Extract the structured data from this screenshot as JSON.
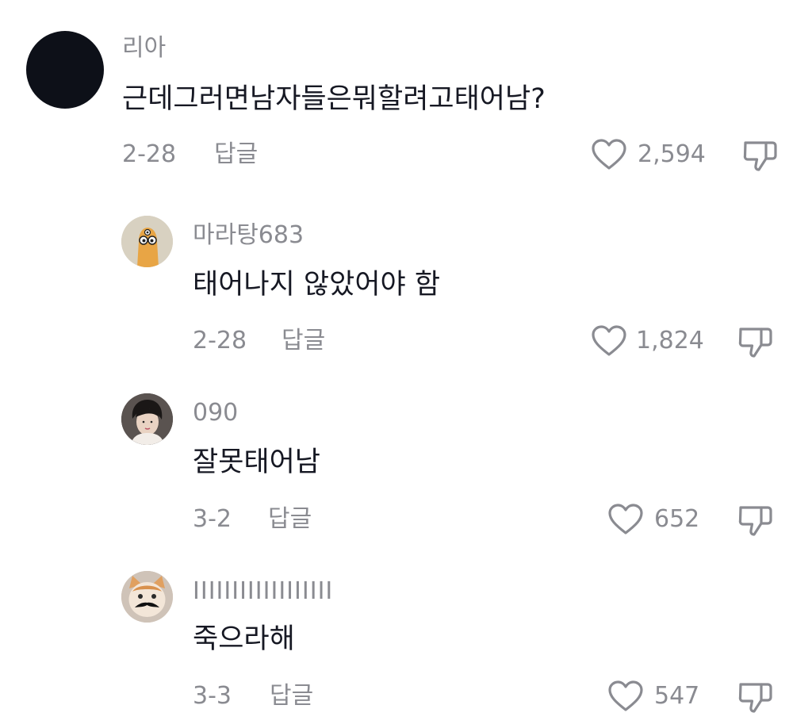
{
  "comments": [
    {
      "username": "리아",
      "text": "근데그러면남자들은뭐할려고태어남?",
      "date": "2-28",
      "reply_label": "답글",
      "likes": "2,594",
      "avatar": "black-circle-avatar"
    },
    {
      "username": "마라탕683",
      "text": "태어나지 않았어야 함",
      "date": "2-28",
      "reply_label": "답글",
      "likes": "1,824",
      "avatar": "cartoon-character-avatar"
    },
    {
      "username": "090",
      "text": "잘못태어남",
      "date": "3-2",
      "reply_label": "답글",
      "likes": "652",
      "avatar": "person-photo-avatar"
    },
    {
      "username": "IIIIIIIIIIIIIIIIII",
      "text": "죽으라해",
      "date": "3-3",
      "reply_label": "답글",
      "likes": "547",
      "avatar": "mustache-cat-avatar"
    }
  ],
  "colors": {
    "primary_text": "#161823",
    "secondary_text": "#8a8b91"
  }
}
